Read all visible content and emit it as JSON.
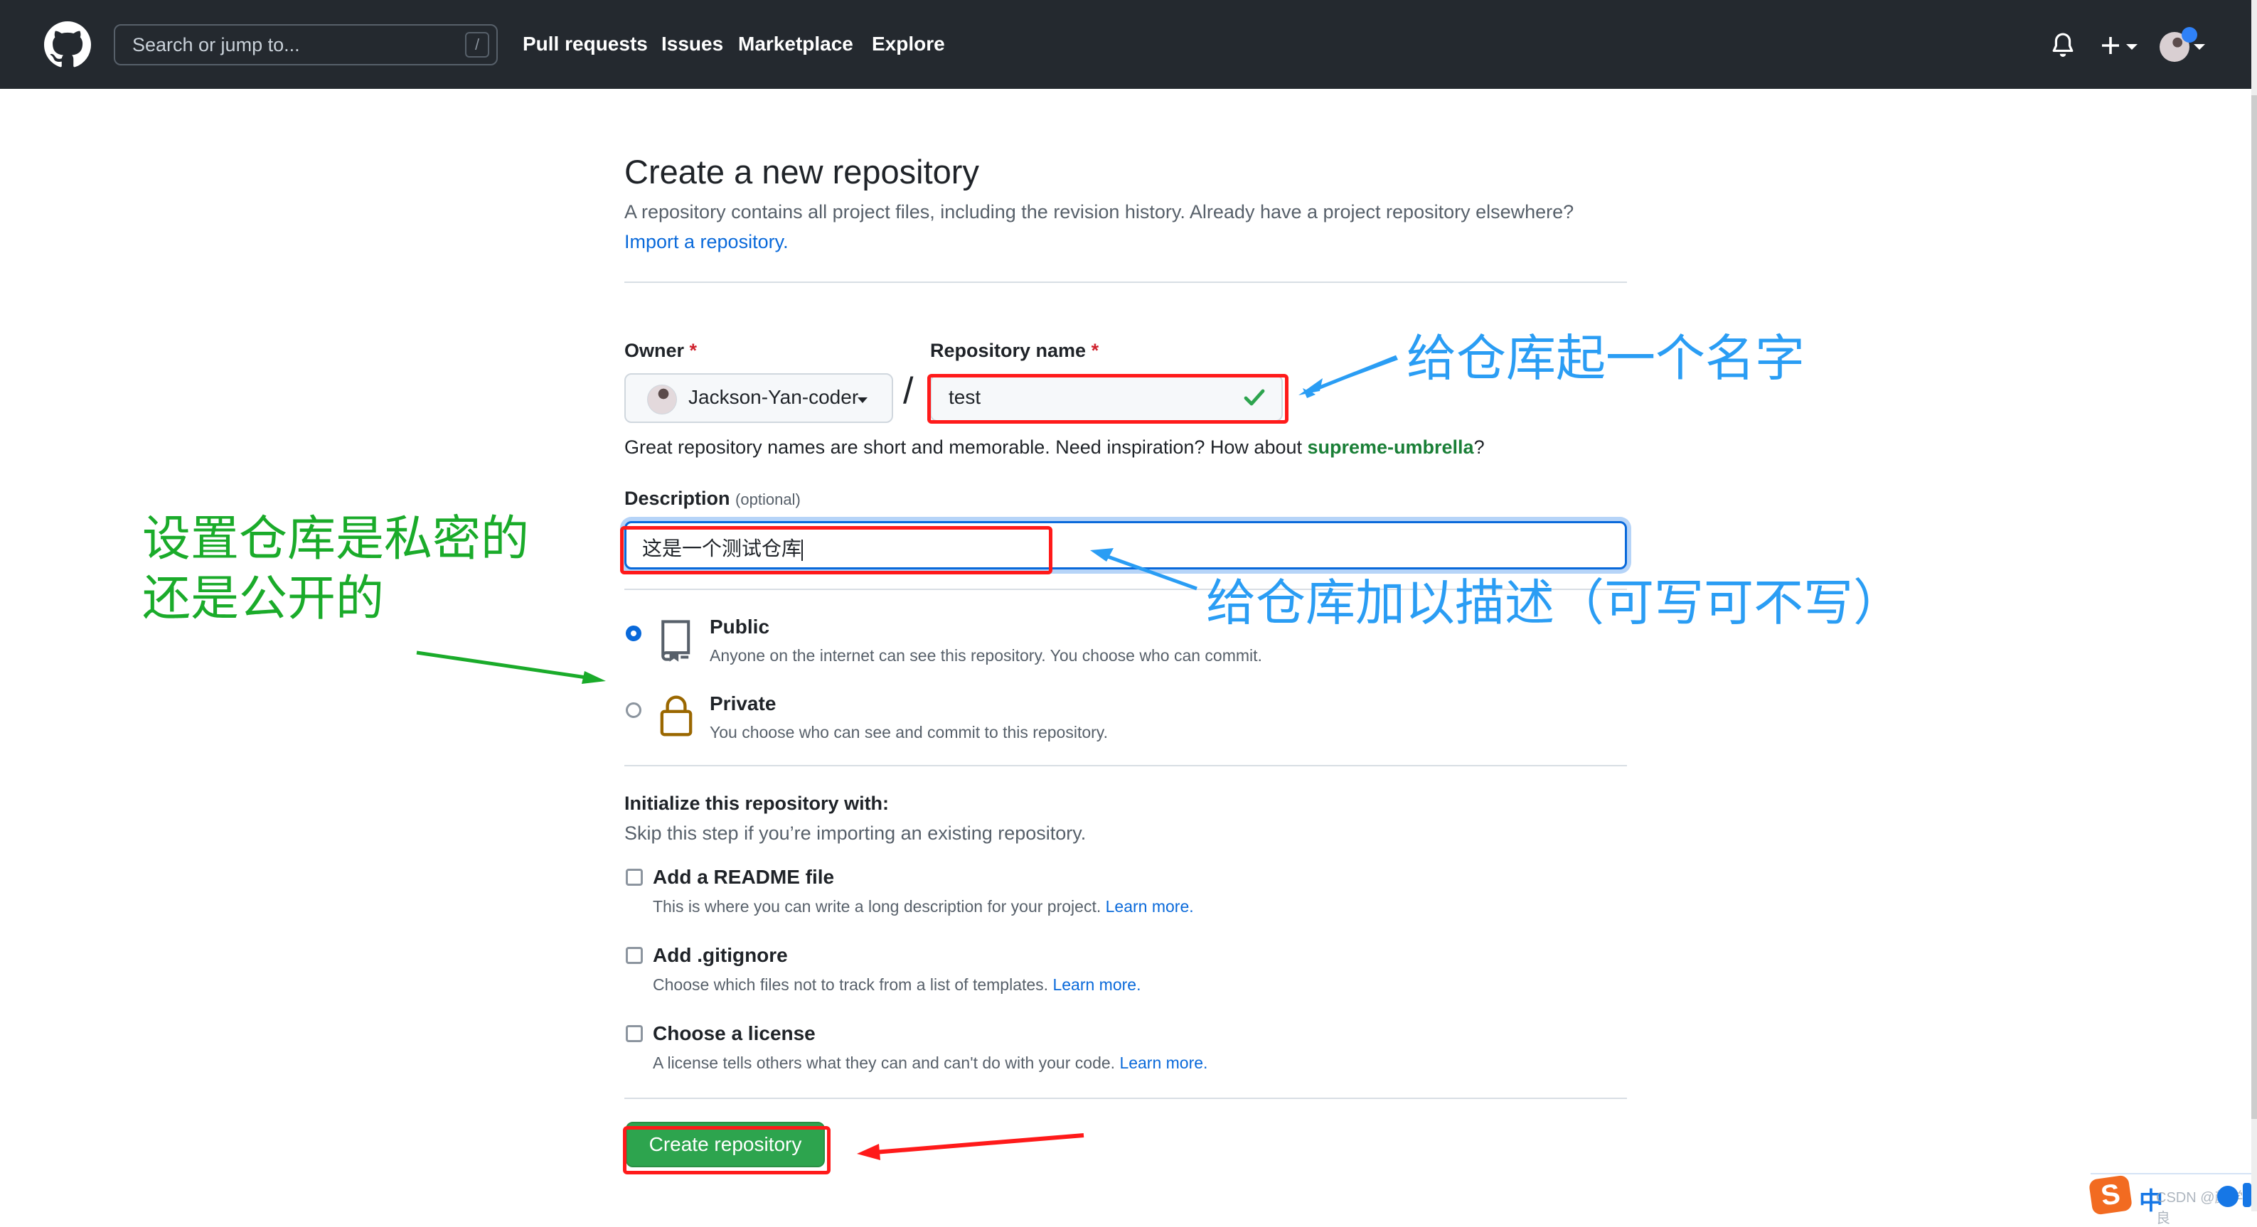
{
  "header": {
    "logo_icon": "github-mark-icon",
    "search_placeholder": "Search or jump to...",
    "search_shortcut": "/",
    "nav": [
      "Pull requests",
      "Issues",
      "Marketplace",
      "Explore"
    ],
    "notification_icon": "bell-icon",
    "create_icon": "plus-icon",
    "avatar_icon": "user-avatar-icon",
    "bg_color": "#24292f"
  },
  "page": {
    "title": "Create a new repository",
    "subtitle": "A repository contains all project files, including the revision history. Already have a project repository elsewhere?",
    "import_link": "Import a repository."
  },
  "form": {
    "owner_label": "Owner",
    "owner_value": "Jackson-Yan-coder",
    "required_mark": "*",
    "slash": "/",
    "repo_name_label": "Repository name",
    "repo_name_value": "test",
    "name_hint_prefix": "Great repository names are short and memorable. Need inspiration? How about ",
    "name_suggestion": "supreme-umbrella",
    "name_hint_suffix": "?",
    "description_label": "Description",
    "description_optional": "(optional)",
    "description_value": "这是一个测试仓库",
    "visibility": {
      "selected": "public",
      "options": [
        {
          "id": "public",
          "label": "Public",
          "description": "Anyone on the internet can see this repository. You choose who can commit.",
          "icon": "repo-book-icon"
        },
        {
          "id": "private",
          "label": "Private",
          "description": "You choose who can see and commit to this repository.",
          "icon": "lock-icon"
        }
      ]
    },
    "init_heading": "Initialize this repository with:",
    "init_sub": "Skip this step if you’re importing an existing repository.",
    "init_options": [
      {
        "label": "Add a README file",
        "description": "This is where you can write a long description for your project.",
        "link": "Learn more.",
        "checked": false
      },
      {
        "label": "Add .gitignore",
        "description": "Choose which files not to track from a list of templates.",
        "link": "Learn more.",
        "checked": false
      },
      {
        "label": "Choose a license",
        "description": "A license tells others what they can and can't do with your code.",
        "link": "Learn more.",
        "checked": false
      }
    ],
    "submit_label": "Create repository",
    "submit_color": "#2da44e"
  },
  "annotations": {
    "name_note": "给仓库起一个名字",
    "description_note": "给仓库加以描述（可写可不写）",
    "visibility_note_line1": "设置仓库是私密的",
    "visibility_note_line2": "还是公开的",
    "blue_color": "#2a9df4",
    "green_color": "#1aab2a",
    "red_color": "#ff1a1a"
  },
  "overlay": {
    "ime_logo": "S",
    "ime_mode": "中",
    "watermark": "CSDN @颜学良"
  }
}
